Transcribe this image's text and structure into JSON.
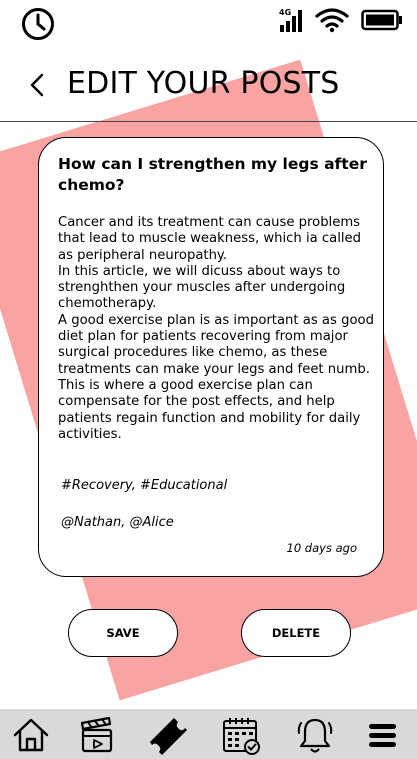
{
  "status_bar": {
    "network_label": "4G",
    "icons": [
      "clock-icon",
      "signal-icon",
      "wifi-icon",
      "battery-icon"
    ]
  },
  "header": {
    "title": "EDIT YOUR POSTS",
    "back_icon": "chevron-left-icon"
  },
  "post": {
    "title": "How can I strengthen my legs after chemo?",
    "body": "Cancer and its treatment can cause problems that lead to muscle weakness, which ia called as peripheral neuropathy.\nIn this article, we will dicuss about ways to strenghthen your muscles after undergoing chemotherapy.\nA good exercise plan is as important as as good diet plan for patients recovering from major surgical procedures like chemo, as these treatments can make your legs and feet numb. This is where a good exercise plan can compensate for the post effects, and help patients regain function and mobility for daily activities.",
    "tags": "#Recovery, #Educational",
    "mentions": "@Nathan, @Alice",
    "timestamp": "10 days ago"
  },
  "actions": {
    "save_label": "SAVE",
    "delete_label": "DELETE"
  },
  "nav": {
    "items": [
      "home-icon",
      "video-icon",
      "ticket-icon",
      "calendar-icon",
      "bell-icon",
      "menu-icon"
    ],
    "active": "ticket-icon"
  },
  "colors": {
    "accent": "#f9a3a3",
    "nav_background": "#d9d9d9"
  }
}
